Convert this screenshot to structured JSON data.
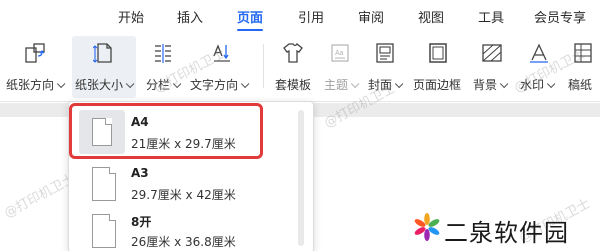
{
  "menubar": {
    "tabs": [
      {
        "label": "开始",
        "active": false
      },
      {
        "label": "插入",
        "active": false
      },
      {
        "label": "页面",
        "active": true
      },
      {
        "label": "引用",
        "active": false
      },
      {
        "label": "审阅",
        "active": false
      },
      {
        "label": "视图",
        "active": false
      },
      {
        "label": "工具",
        "active": false
      },
      {
        "label": "会员专享",
        "active": false
      }
    ]
  },
  "ribbon": {
    "orientation": "纸张方向",
    "paper_size": "纸张大小",
    "columns": "分栏",
    "text_direction": "文字方向",
    "template": "套模板",
    "theme": "主题",
    "cover": "封面",
    "page_border": "页面边框",
    "background": "背景",
    "watermark": "水印",
    "manuscript": "稿纸"
  },
  "dropdown": {
    "items": [
      {
        "name": "A4",
        "size": "21厘米  x  29.7厘米",
        "selected": true
      },
      {
        "name": "A3",
        "size": "29.7厘米  x  42厘米",
        "selected": false
      },
      {
        "name": "8开",
        "size": "26厘米  x  36.8厘米",
        "selected": false
      }
    ]
  },
  "watermark_text": "@打印机卫士",
  "logo_text": "二泉软件园",
  "colors": {
    "accent": "#2468f2",
    "highlight": "#e03a3a",
    "ribbon_active_bg": "#eceff3"
  }
}
